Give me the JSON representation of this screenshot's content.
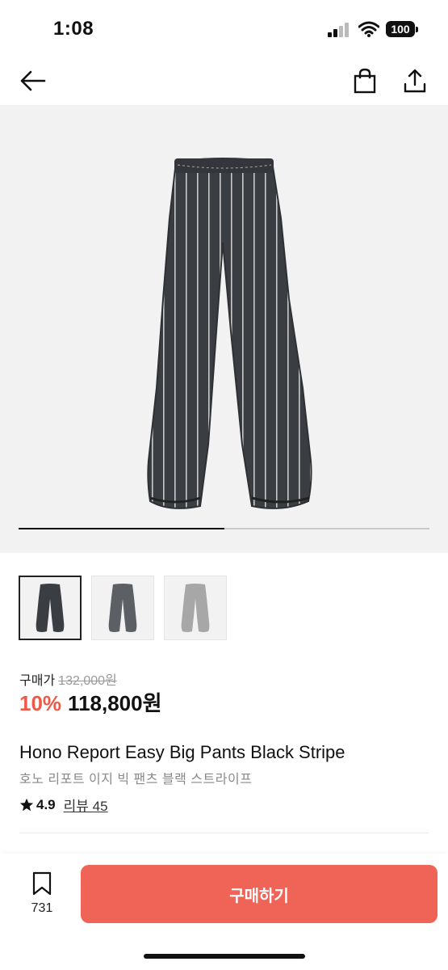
{
  "status_bar": {
    "time": "1:08",
    "battery": "100"
  },
  "product": {
    "price_label": "구매가",
    "original_price": "132,000원",
    "discount": "10%",
    "sale_price": "118,800원",
    "title_en": "Hono Report Easy Big Pants Black Stripe",
    "title_ko": "호노 리포트 이지 빅 팬츠 블랙 스트라이프",
    "rating": "4.9",
    "review_label": "리뷰 45"
  },
  "gallery": {
    "progress": 0.5,
    "thumbnails": [
      {
        "color": "#3a3d42",
        "selected": true
      },
      {
        "color": "#5c5f63",
        "selected": false
      },
      {
        "color": "#a7a7a7",
        "selected": false
      }
    ]
  },
  "bottom_bar": {
    "bookmark_count": "731",
    "buy_label": "구매하기"
  },
  "colors": {
    "accent": "#ef6456",
    "discount": "#ee5a48"
  },
  "icons": [
    "back-arrow-icon",
    "shopping-bag-icon",
    "share-icon",
    "bookmark-icon",
    "star-icon"
  ]
}
